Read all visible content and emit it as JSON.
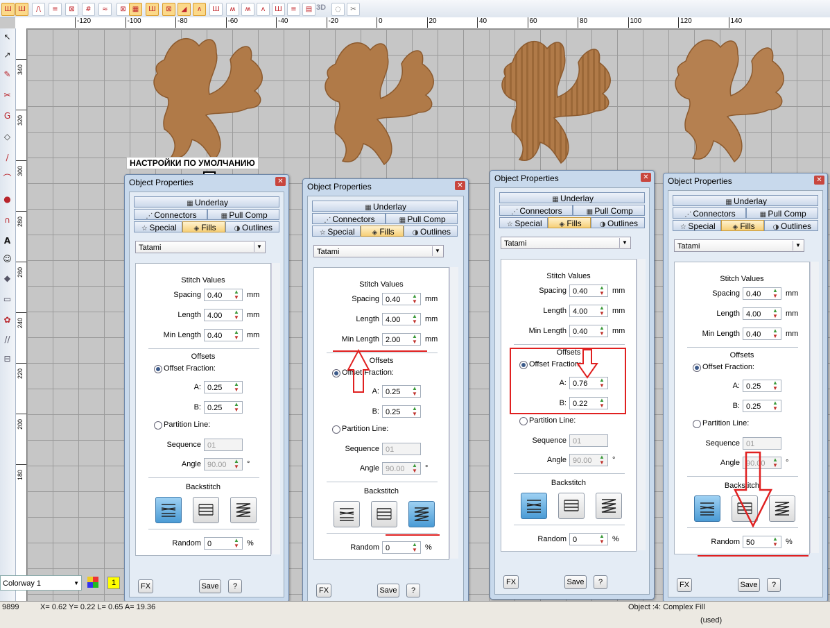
{
  "toolbar": {
    "label_3d": "3D"
  },
  "ruler": {
    "h_labels": [
      "-120",
      "-100",
      "-80",
      "-60",
      "-40",
      "-20",
      "0",
      "20",
      "40",
      "60",
      "80",
      "100",
      "120",
      "140"
    ],
    "v_labels": [
      "340",
      "320",
      "300",
      "280",
      "260",
      "240",
      "220",
      "200",
      "180"
    ]
  },
  "annotation": {
    "defaults_label": "НАСТРОЙКИ ПО УМОЛЧАНИЮ"
  },
  "colors": {
    "accent": "#e02020",
    "embroidery": "#b07a48",
    "panel_bg": "#c8d9ec"
  },
  "panels": [
    {
      "title": "Object Properties",
      "tabs": {
        "underlay": "Underlay",
        "connectors": "Connectors",
        "pull_comp": "Pull Comp",
        "special": "Special",
        "fills": "Fills",
        "outlines": "Outlines"
      },
      "fill_type": "Tatami",
      "stitch_values": "Stitch Values",
      "spacing_label": "Spacing",
      "spacing": "0.40",
      "length_label": "Length",
      "length": "4.00",
      "min_length_label": "Min Length",
      "min_length": "0.40",
      "unit_mm": "mm",
      "offsets": "Offsets",
      "offset_fraction": "Offset Fraction:",
      "a_label": "A:",
      "a": "0.25",
      "b_label": "B:",
      "b": "0.25",
      "partition_line": "Partition Line:",
      "sequence_label": "Sequence",
      "sequence": "01",
      "angle_label": "Angle",
      "angle": "90.00",
      "degree": "°",
      "backstitch": "Backstitch",
      "backstitch_selected": 0,
      "random_label": "Random",
      "random": "0",
      "percent": "%",
      "fx": "FX",
      "save": "Save",
      "help": "?"
    },
    {
      "title": "Object Properties",
      "tabs": {
        "underlay": "Underlay",
        "connectors": "Connectors",
        "pull_comp": "Pull Comp",
        "special": "Special",
        "fills": "Fills",
        "outlines": "Outlines"
      },
      "fill_type": "Tatami",
      "stitch_values": "Stitch Values",
      "spacing_label": "Spacing",
      "spacing": "0.40",
      "length_label": "Length",
      "length": "4.00",
      "min_length_label": "Min Length",
      "min_length": "2.00",
      "unit_mm": "mm",
      "offsets": "Offsets",
      "offset_fraction": "Offset Fraction:",
      "a_label": "A:",
      "a": "0.25",
      "b_label": "B:",
      "b": "0.25",
      "partition_line": "Partition Line:",
      "sequence_label": "Sequence",
      "sequence": "01",
      "angle_label": "Angle",
      "angle": "90.00",
      "degree": "°",
      "backstitch": "Backstitch",
      "backstitch_selected": 2,
      "random_label": "Random",
      "random": "0",
      "percent": "%",
      "fx": "FX",
      "save": "Save",
      "help": "?"
    },
    {
      "title": "Object Properties",
      "tabs": {
        "underlay": "Underlay",
        "connectors": "Connectors",
        "pull_comp": "Pull Comp",
        "special": "Special",
        "fills": "Fills",
        "outlines": "Outlines"
      },
      "fill_type": "Tatami",
      "stitch_values": "Stitch Values",
      "spacing_label": "Spacing",
      "spacing": "0.40",
      "length_label": "Length",
      "length": "4.00",
      "min_length_label": "Min Length",
      "min_length": "0.40",
      "unit_mm": "mm",
      "offsets": "Offsets",
      "offset_fraction": "Offset Fraction:",
      "a_label": "A:",
      "a": "0.76",
      "b_label": "B:",
      "b": "0.22",
      "partition_line": "Partition Line:",
      "sequence_label": "Sequence",
      "sequence": "01",
      "angle_label": "Angle",
      "angle": "90.00",
      "degree": "°",
      "backstitch": "Backstitch",
      "backstitch_selected": 0,
      "random_label": "Random",
      "random": "0",
      "percent": "%",
      "fx": "FX",
      "save": "Save",
      "help": "?"
    },
    {
      "title": "Object Properties",
      "tabs": {
        "underlay": "Underlay",
        "connectors": "Connectors",
        "pull_comp": "Pull Comp",
        "special": "Special",
        "fills": "Fills",
        "outlines": "Outlines"
      },
      "fill_type": "Tatami",
      "stitch_values": "Stitch Values",
      "spacing_label": "Spacing",
      "spacing": "0.40",
      "length_label": "Length",
      "length": "4.00",
      "min_length_label": "Min Length",
      "min_length": "0.40",
      "unit_mm": "mm",
      "offsets": "Offsets",
      "offset_fraction": "Offset Fraction:",
      "a_label": "A:",
      "a": "0.25",
      "b_label": "B:",
      "b": "0.25",
      "partition_line": "Partition Line:",
      "sequence_label": "Sequence",
      "sequence": "01",
      "angle_label": "Angle",
      "angle": "90.00",
      "degree": "°",
      "backstitch": "Backstitch",
      "backstitch_selected": 0,
      "random_label": "Random",
      "random": "50",
      "percent": "%",
      "fx": "FX",
      "save": "Save",
      "help": "?"
    }
  ],
  "statusbar": {
    "colorway": "Colorway 1",
    "badge": "1",
    "stitch_count": "9899",
    "coords": "X=   0.62 Y=   0.22 L=   0.65 A=  19.36",
    "object_info": "Object :4: Complex Fill",
    "used": "(used)"
  }
}
